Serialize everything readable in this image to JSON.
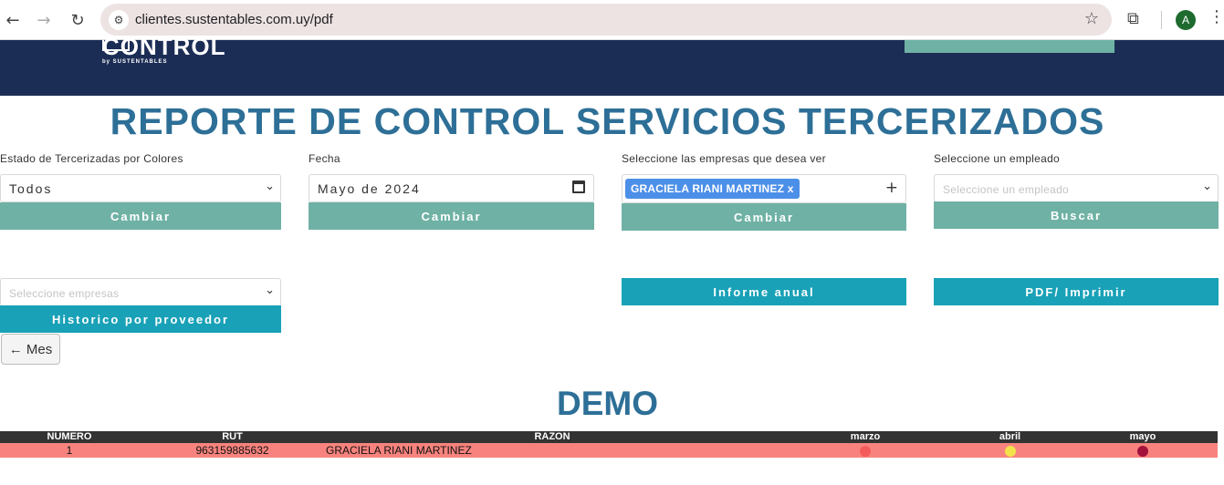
{
  "browser": {
    "url": "clientes.sustentables.com.uy/pdf",
    "back_icon": "←",
    "forward_icon": "→",
    "reload_icon": "↻",
    "tune_icon": "⚙",
    "star_icon": "☆",
    "extensions_icon": "⧉",
    "profile_initial": "A",
    "menu_icon": "⋮"
  },
  "header": {
    "logo_text": "CONTROL",
    "logo_sub": "by SUSTENTABLES"
  },
  "page_title": "REPORTE DE CONTROL SERVICIOS TERCERIZADOS",
  "filters": {
    "estado": {
      "label": "Estado de Tercerizadas por Colores",
      "value": "Todos",
      "button": "Cambiar"
    },
    "fecha": {
      "label": "Fecha",
      "value": "Mayo de 2024",
      "button": "Cambiar"
    },
    "empresas": {
      "label": "Seleccione las empresas que desea ver",
      "tag": "GRACIELA RIANI MARTINEZ",
      "tag_remove": "x",
      "add_icon": "+",
      "button": "Cambiar"
    },
    "empleado": {
      "label": "Seleccione un empleado",
      "placeholder": "Seleccione un empleado",
      "button": "Buscar"
    }
  },
  "row2": {
    "empresas_placeholder": "Seleccione empresas",
    "historico_button": "Historico por proveedor",
    "informe_button": "Informe anual",
    "pdf_button": "PDF/ Imprimir",
    "back_button": "← Mes"
  },
  "demo_title": "DEMO",
  "table": {
    "headers": [
      "NUMERO",
      "RUT",
      "RAZON",
      "marzo",
      "abril",
      "mayo"
    ],
    "rows": [
      {
        "numero": "1",
        "rut": "963159885632",
        "razon": "GRACIELA RIANI MARTINEZ",
        "status_colors": [
          "#f45c5c",
          "#f3e14a",
          "#a3123a"
        ]
      }
    ]
  },
  "colors": {
    "header_bg": "#1c2d55",
    "title": "#2d6f97",
    "green_button": "#6fb2a5",
    "teal_button": "#19a1b7",
    "row_bg": "#f8837e"
  }
}
